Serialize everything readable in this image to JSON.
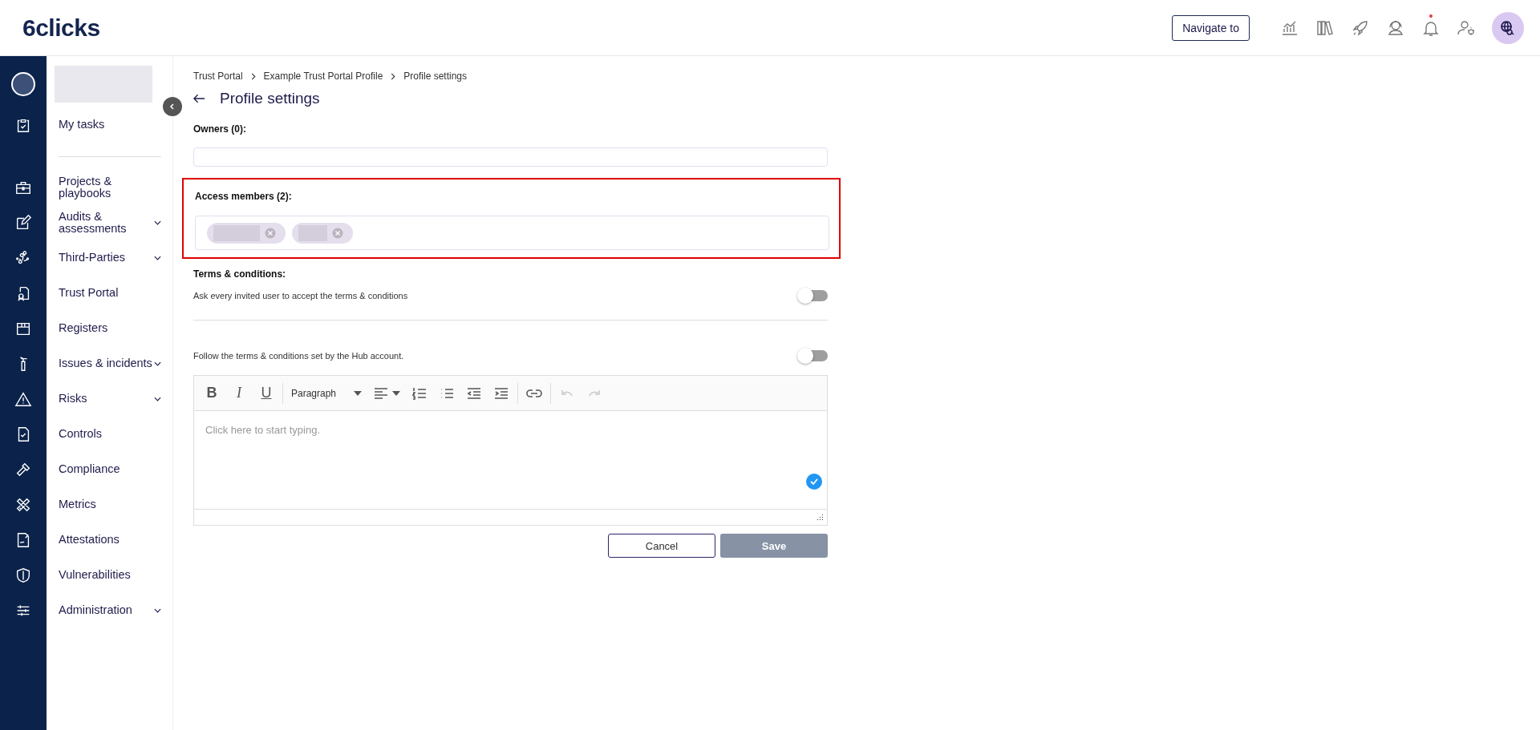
{
  "header": {
    "logo": "6clicks",
    "navigate_button": "Navigate to",
    "notification_dot": true
  },
  "sidebar": {
    "top_items": [
      {
        "label": "My tasks",
        "expandable": false
      }
    ],
    "items": [
      {
        "label": "Projects & playbooks",
        "expandable": false
      },
      {
        "label": "Audits & assessments",
        "expandable": true
      },
      {
        "label": "Third-Parties",
        "expandable": true
      },
      {
        "label": "Trust Portal",
        "expandable": false
      },
      {
        "label": "Registers",
        "expandable": false
      },
      {
        "label": "Issues & incidents",
        "expandable": true
      },
      {
        "label": "Risks",
        "expandable": true
      },
      {
        "label": "Controls",
        "expandable": false
      },
      {
        "label": "Compliance",
        "expandable": false
      },
      {
        "label": "Metrics",
        "expandable": false
      },
      {
        "label": "Attestations",
        "expandable": false
      },
      {
        "label": "Vulnerabilities",
        "expandable": false
      },
      {
        "label": "Administration",
        "expandable": true
      }
    ]
  },
  "breadcrumb": [
    "Trust Portal",
    "Example Trust Portal Profile",
    "Profile settings"
  ],
  "title": "Profile settings",
  "owners": {
    "label": "Owners (0):"
  },
  "access_members": {
    "label": "Access members (2):",
    "highlighted": true,
    "chips": [
      {
        "removable": true
      },
      {
        "removable": true
      }
    ]
  },
  "terms": {
    "label": "Terms & conditions:",
    "toggles": [
      {
        "label": "Ask every invited user to accept the terms & conditions",
        "on": false
      },
      {
        "label": "Follow the terms & conditions set by the Hub account.",
        "on": false
      }
    ]
  },
  "editor": {
    "format_buttons": [
      "B",
      "I",
      "U"
    ],
    "block_format": "Paragraph",
    "placeholder": "Click here to start typing.",
    "undo_disabled": true,
    "redo_disabled": true
  },
  "buttons": {
    "cancel": "Cancel",
    "save": "Save",
    "save_disabled": true
  }
}
